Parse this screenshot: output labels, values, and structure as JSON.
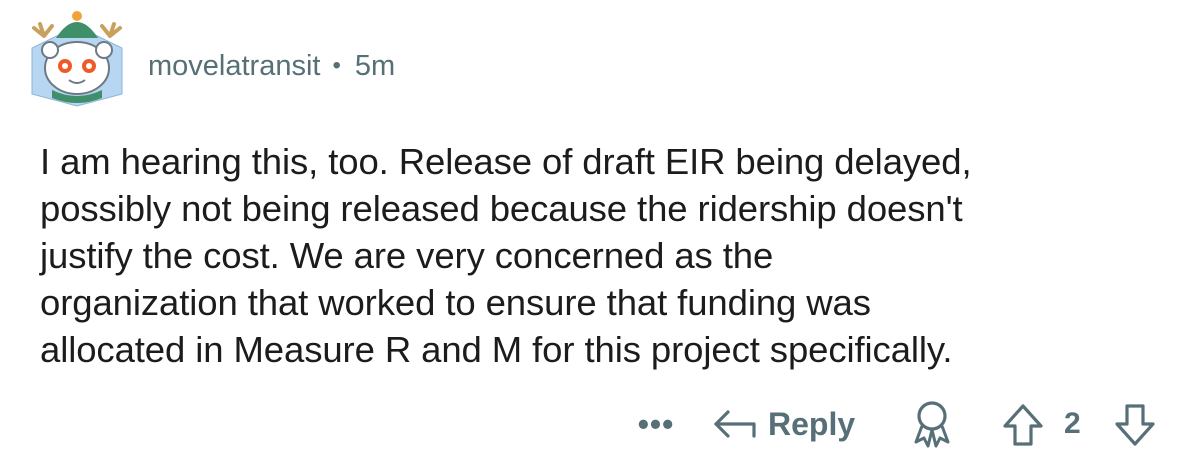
{
  "comment": {
    "author": "movelatransit",
    "separator": "•",
    "age": "5m",
    "avatar_icon": "snoo-avatar-icon",
    "body_lines": [
      "I am hearing this, too. Release of draft EIR being delayed,",
      "possibly not being released because the ridership doesn't",
      "justify the cost. We are very concerned as the",
      "organization that worked to ensure that funding was",
      "allocated in Measure R and M for this project specifically."
    ]
  },
  "actions": {
    "more_label": "•••",
    "reply_label": "Reply",
    "reply_icon": "reply-arrow-icon",
    "award_icon": "award-icon",
    "upvote_icon": "upvote-icon",
    "vote_count": "2",
    "downvote_icon": "downvote-icon"
  },
  "colors": {
    "text": "#1c1c1c",
    "meta": "#576f76",
    "avatar_frame": "#a7c7e7"
  }
}
